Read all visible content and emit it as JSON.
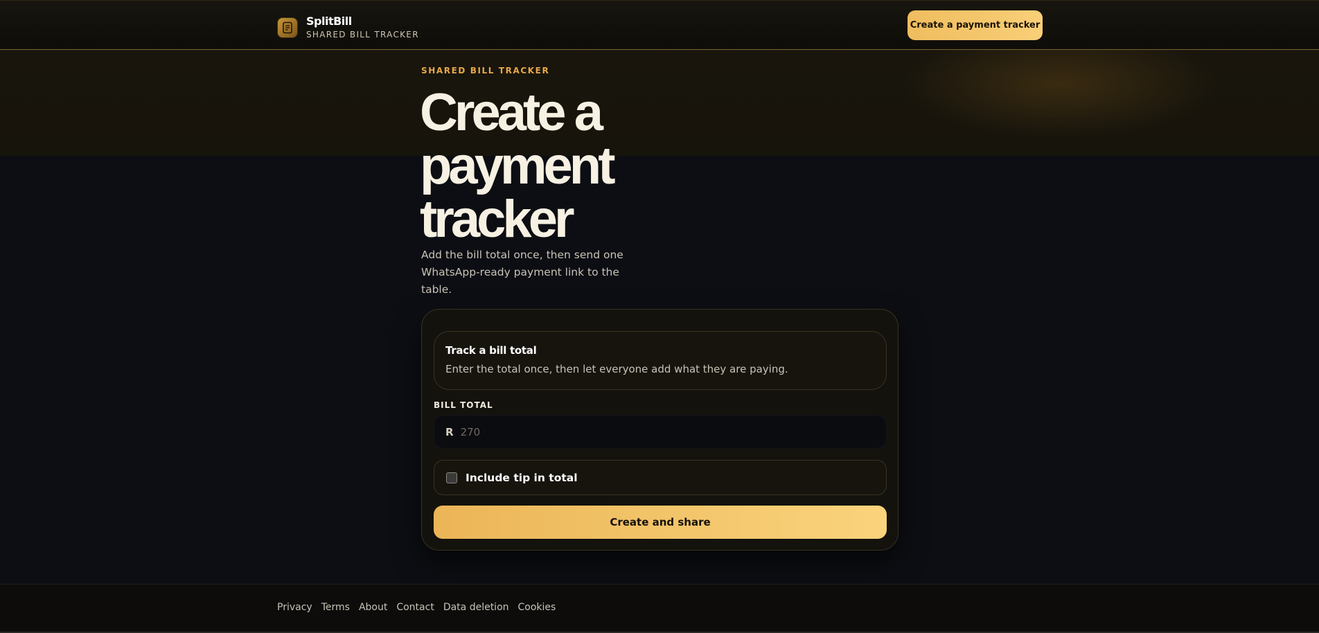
{
  "header": {
    "brand_name": "SplitBill",
    "brand_sub": "SHARED BILL TRACKER",
    "cta_label": "Create a payment tracker"
  },
  "hero": {
    "eyebrow": "SHARED BILL TRACKER",
    "title": "Create a payment tracker",
    "lede": "Add the bill total once, then send one WhatsApp-ready payment link to the table."
  },
  "form": {
    "info_title": "Track a bill total",
    "info_text": "Enter the total once, then let everyone add what they are paying.",
    "bill_total_label": "BILL TOTAL",
    "currency_symbol": "R",
    "bill_total_value": "",
    "bill_total_placeholder": "270",
    "tip_label": "Include tip in total",
    "tip_checked": false,
    "submit_label": "Create and share"
  },
  "footer": {
    "links": [
      "Privacy",
      "Terms",
      "About",
      "Contact",
      "Data deletion",
      "Cookies"
    ]
  },
  "colors": {
    "accent": "#f3c46a",
    "accent_text": "#e8a849",
    "background": "#0c0e13",
    "card": "#14120d"
  },
  "icons": {
    "logo": "receipt-icon"
  }
}
